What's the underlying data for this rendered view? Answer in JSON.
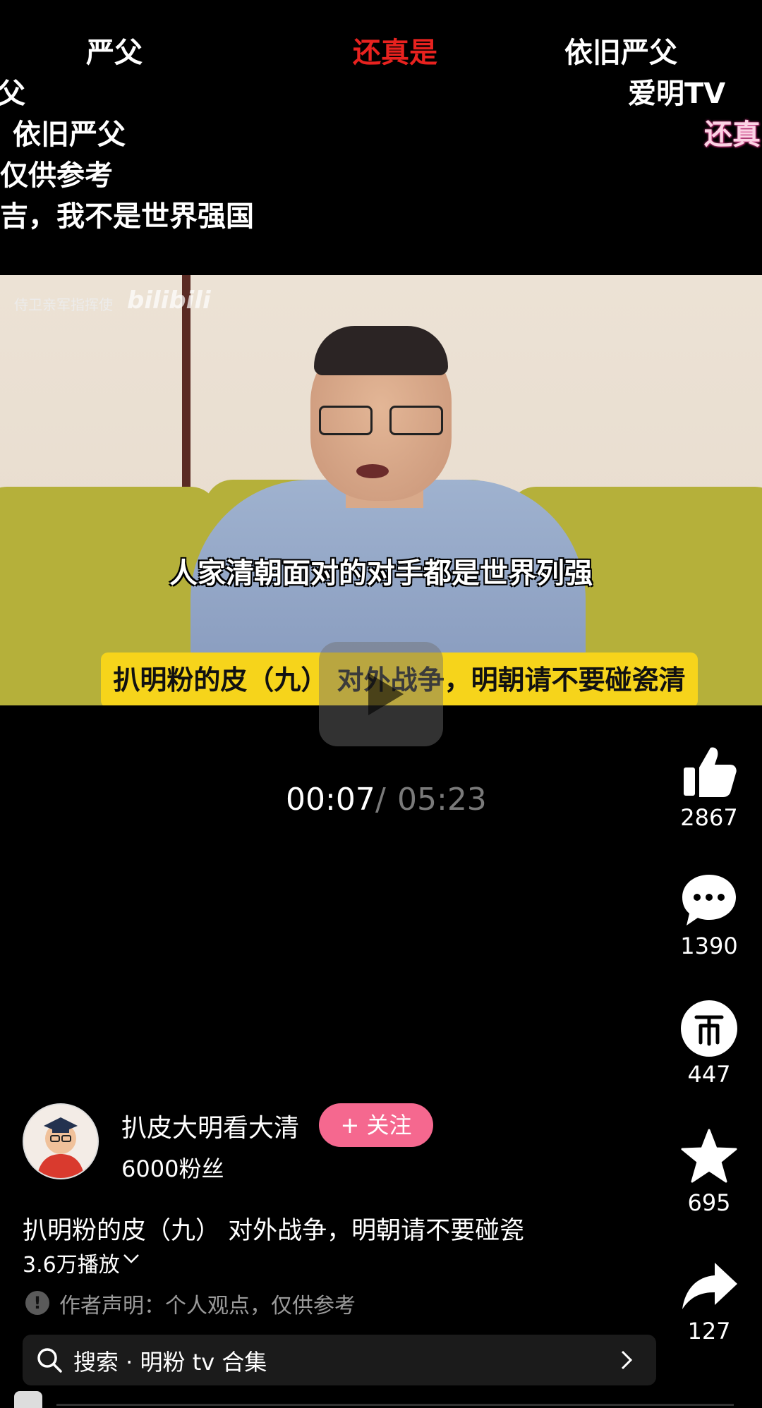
{
  "danmaku": [
    "严父",
    "还真是",
    "依旧严父",
    "父",
    "爱明TV",
    "依旧严父",
    "还真",
    "仅供参考",
    "吉，我不是世界强国"
  ],
  "video": {
    "watermark": "侍卫亲军指挥使",
    "watermark_logo": "bilibili",
    "subtitle": "人家清朝面对的对手都是世界列强",
    "banner": "扒明粉的皮（九） 对外战争，明朝请不要碰瓷清朝"
  },
  "playback": {
    "current": "00:07",
    "separator": "/",
    "total": "05:23"
  },
  "actions": {
    "like": {
      "icon": "thumbs-up-icon",
      "count": "2867"
    },
    "comment": {
      "icon": "comment-bubble-icon",
      "count": "1390"
    },
    "coin": {
      "icon": "coin-icon",
      "count": "447"
    },
    "favorite": {
      "icon": "star-icon",
      "count": "695"
    },
    "share": {
      "icon": "share-arrow-icon",
      "count": "127"
    }
  },
  "author": {
    "name": "扒皮大明看大清",
    "follow_label": "+ 关注",
    "fans": "6000粉丝"
  },
  "video_info": {
    "title": "扒明粉的皮（九） 对外战争，明朝请不要碰瓷",
    "play_count": "3.6万播放",
    "disclaimer_icon": "!",
    "disclaimer": "作者声明：个人观点，仅供参考"
  },
  "search": {
    "label": "搜索 · 明粉 tv 合集"
  },
  "colors": {
    "follow": "#f5688f",
    "banner": "#f6d41b",
    "danmaku_red": "#e8221f"
  }
}
